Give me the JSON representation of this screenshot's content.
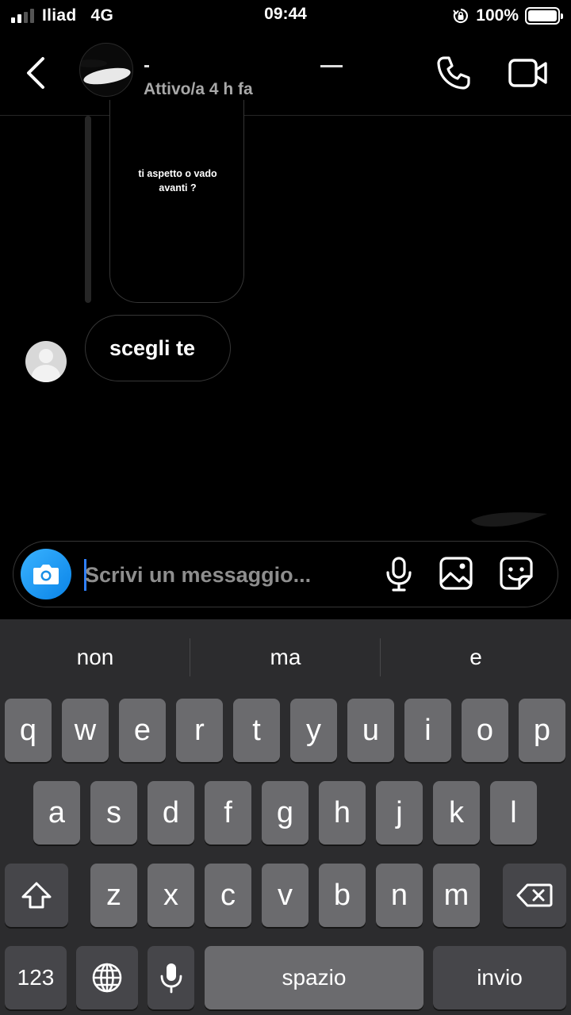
{
  "status_bar": {
    "carrier": "Iliad",
    "network": "4G",
    "time": "09:44",
    "battery_percent": "100%",
    "battery_level": 1.0,
    "signal_bars_active": 2,
    "signal_bars_total": 4
  },
  "header": {
    "status": "Attivo/a 4 h fa",
    "icons": {
      "back": "chevron-left-icon",
      "call": "phone-icon",
      "video": "video-camera-icon"
    }
  },
  "messages": {
    "story_reply_text": "ti aspetto o vado avanti ?",
    "received_text": "scegli te"
  },
  "composer": {
    "placeholder": "Scrivi un messaggio...",
    "value": "",
    "accent_color": "#1da1f2",
    "icons": [
      "camera-icon",
      "microphone-icon",
      "gallery-icon",
      "sticker-icon"
    ]
  },
  "keyboard": {
    "suggestions": [
      "non",
      "ma",
      "e"
    ],
    "row1": [
      "q",
      "w",
      "e",
      "r",
      "t",
      "y",
      "u",
      "i",
      "o",
      "p"
    ],
    "row2": [
      "a",
      "s",
      "d",
      "f",
      "g",
      "h",
      "j",
      "k",
      "l"
    ],
    "row3": [
      "z",
      "x",
      "c",
      "v",
      "b",
      "n",
      "m"
    ],
    "numbers_label": "123",
    "space_label": "spazio",
    "return_label": "invio",
    "icons": [
      "shift-icon",
      "backspace-icon",
      "globe-icon",
      "dictation-mic-icon"
    ]
  }
}
